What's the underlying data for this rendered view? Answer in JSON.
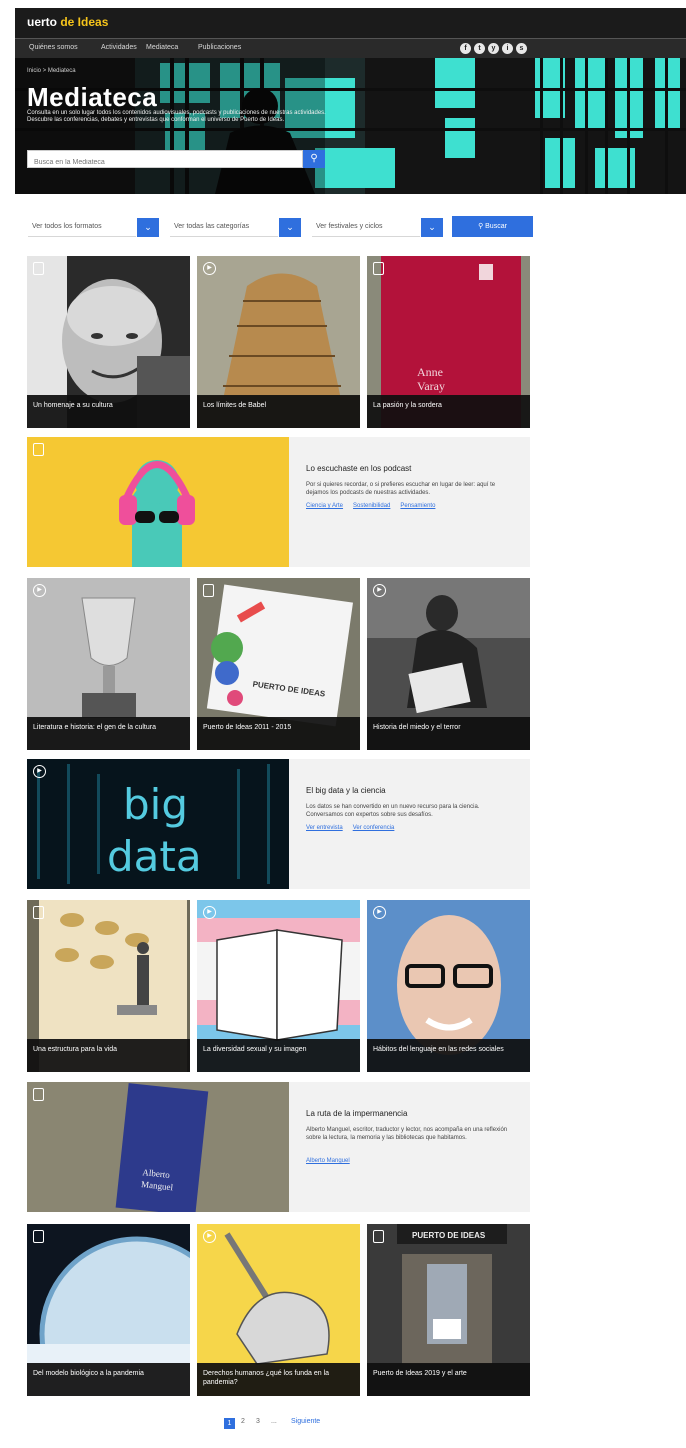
{
  "header": {
    "logo_prefix": "",
    "logo_main": "uerto",
    "logo_accent": "de Ideas",
    "nav": [
      "Quiénes somos",
      "Actividades",
      "Mediateca",
      "Publicaciones"
    ],
    "social": [
      "f",
      "t",
      "y",
      "i",
      "s"
    ]
  },
  "hero": {
    "breadcrumb": "Inicio > Mediateca",
    "title": "Mediateca",
    "description": "Consulta en un solo lugar todos los contenidos audiovisuales, podcasts y publicaciones de nuestras actividades. Descubre las conferencias, debates y entrevistas que conforman el universo de Puerto de Ideas.",
    "search_placeholder": "Busca en la Mediateca"
  },
  "filters": {
    "formats": "Ver todos los formatos",
    "categories": "Ver todas las categorías",
    "festivals": "Ver festivales y ciclos",
    "search_label": "Buscar"
  },
  "cards_row1": [
    {
      "title": "Un homenaje a su cultura",
      "badge": "doc"
    },
    {
      "title": "Los límites de Babel",
      "badge": "play"
    },
    {
      "title": "La pasión y la sordera",
      "badge": "doc"
    }
  ],
  "feature1": {
    "title": "Lo escuchaste en los podcast",
    "description": "Por si quieres recordar, o si prefieres escuchar en lugar de leer: aquí te dejamos los podcasts de nuestras actividades.",
    "links": [
      "Ciencia y Arte",
      "Sostenibilidad",
      "Pensamiento"
    ]
  },
  "cards_row2": [
    {
      "title": "Literatura e historia: el gen de la cultura",
      "badge": "play"
    },
    {
      "title": "Puerto de Ideas 2011 - 2015",
      "badge": "doc"
    },
    {
      "title": "Historia del miedo y el terror",
      "badge": "play"
    }
  ],
  "feature2": {
    "title": "El big data y la ciencia",
    "description": "Los datos se han convertido en un nuevo recurso para la ciencia. Conversamos con expertos sobre sus desafíos.",
    "links": [
      "Ver entrevista",
      "Ver conferencia"
    ]
  },
  "cards_row3": [
    {
      "title": "Una estructura para la vida",
      "badge": "doc"
    },
    {
      "title": "La diversidad sexual y su imagen",
      "badge": "play"
    },
    {
      "title": "Hábitos del lenguaje en las redes sociales",
      "badge": "play"
    }
  ],
  "feature3": {
    "title": "La ruta de la impermanencia",
    "description": "Alberto Manguel, escritor, traductor y lector, nos acompaña en una reflexión sobre la lectura, la memoria y las bibliotecas que habitamos.",
    "links": [
      "Alberto Manguel"
    ]
  },
  "cards_row4": [
    {
      "title": "Del modelo biológico a la pandemia",
      "badge": "doc"
    },
    {
      "title": "Derechos humanos ¿qué los funda en la pandemia?",
      "badge": "play"
    },
    {
      "title": "Puerto de Ideas 2019 y el arte",
      "badge": "doc"
    }
  ],
  "pagination": {
    "pages": [
      "1",
      "2",
      "3",
      "..."
    ],
    "next": "Siguiente"
  },
  "colors": {
    "accent": "#2f6fde",
    "dark": "#1b1b1b",
    "logo_accent": "#f5c41b"
  }
}
